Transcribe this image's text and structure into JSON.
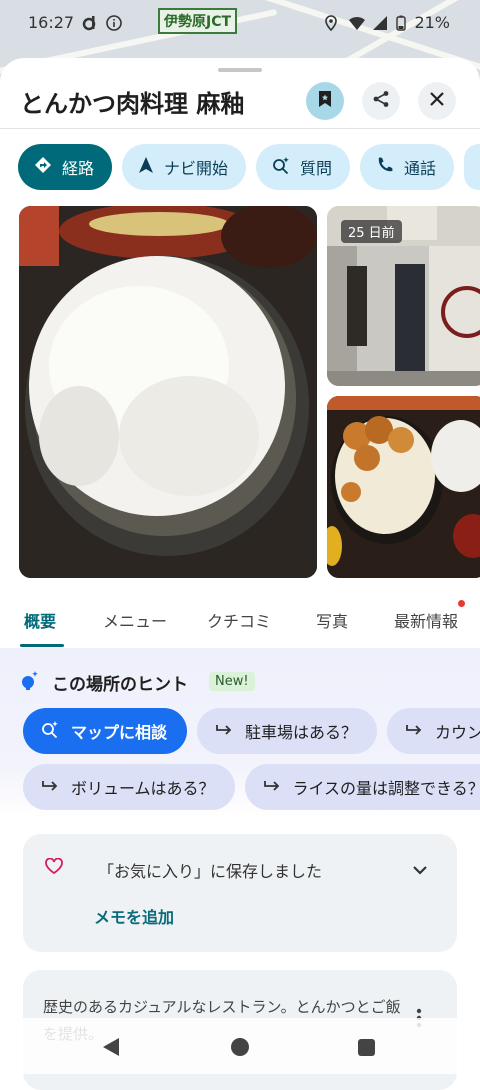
{
  "status": {
    "time": "16:27",
    "battery": "21%",
    "map_label": "伊勢原JCT"
  },
  "place": {
    "name": "とんかつ肉料理 麻釉"
  },
  "actions": [
    {
      "label": "経路",
      "icon": "directions-icon"
    },
    {
      "label": "ナビ開始",
      "icon": "navigation-icon"
    },
    {
      "label": "質問",
      "icon": "ask-sparkle-icon"
    },
    {
      "label": "通話",
      "icon": "phone-icon"
    }
  ],
  "photos": {
    "recent_badge": "25 日前"
  },
  "tabs": [
    "概要",
    "メニュー",
    "クチコミ",
    "写真",
    "最新情報"
  ],
  "hints": {
    "title": "この場所のヒント",
    "new_badge": "New!",
    "row1": [
      "マップに相談",
      "駐車場はある？",
      "カウン"
    ],
    "row2": [
      "ボリュームはある？",
      "ライスの量は調整できる？"
    ]
  },
  "saved_card": {
    "text": "「お気に入り」に保存しました",
    "link": "メモを追加"
  },
  "summary_card": {
    "text": "歴史のあるカジュアルなレストラン。とんかつとご飯を提供。"
  },
  "colors": {
    "accent": "#006a7a",
    "chip_bg": "#d3eefa",
    "hint_primary": "#1a6ef0",
    "notification_dot": "#e53935"
  }
}
